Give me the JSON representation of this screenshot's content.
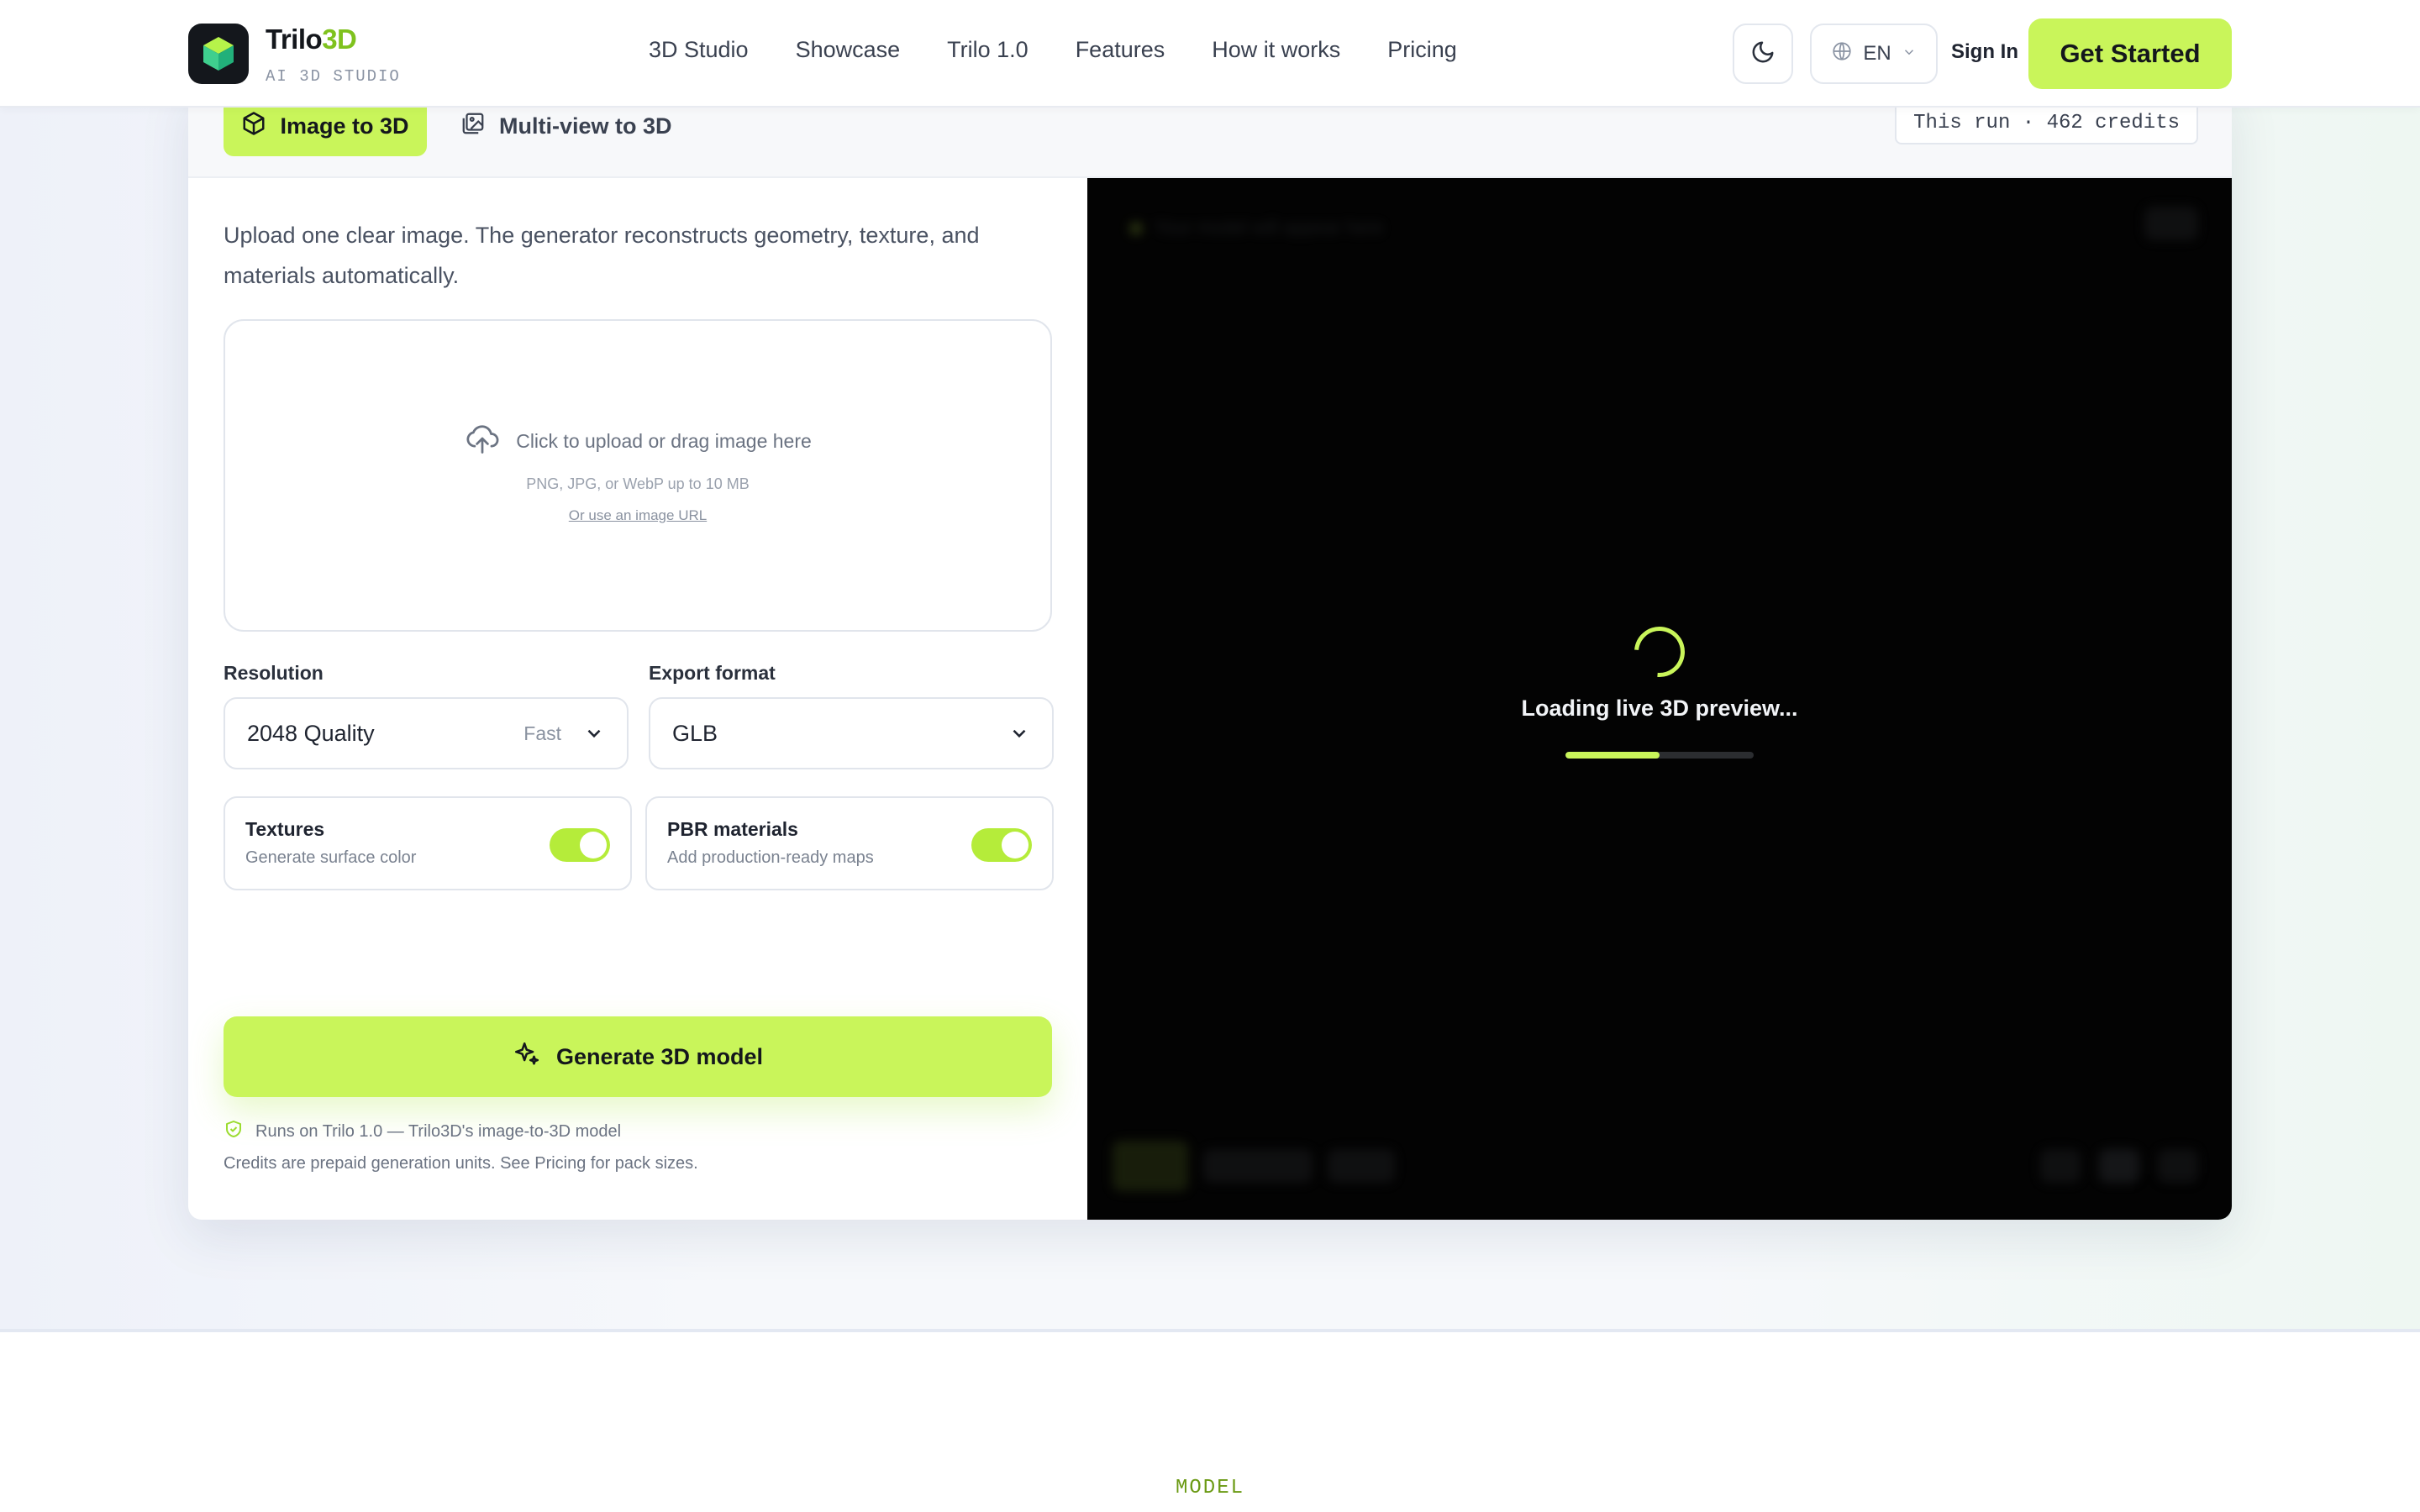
{
  "brand": {
    "name": "Trilo",
    "name_accent": "3D",
    "tagline": "AI 3D STUDIO",
    "accent_color": "#c9f55a"
  },
  "nav": {
    "items": [
      "3D Studio",
      "Showcase",
      "Trilo 1.0",
      "Features",
      "How it works",
      "Pricing"
    ]
  },
  "header": {
    "theme_icon": "moon-icon",
    "language": "EN",
    "sign_in": "Sign In",
    "cta": "Get Started"
  },
  "tabs": {
    "active": "Image to 3D",
    "inactive": "Multi-view to 3D"
  },
  "credits": {
    "label": "This run · 462 credits"
  },
  "intro": "Upload one clear image. The generator reconstructs geometry, texture, and materials automatically.",
  "upload": {
    "main": "Click to upload or drag image here",
    "sub": "PNG, JPG, or WebP up to 10 MB",
    "link": "Or use an image URL"
  },
  "resolution": {
    "label": "Resolution",
    "value": "2048 Quality",
    "hint": "Fast"
  },
  "export": {
    "label": "Export format",
    "value": "GLB"
  },
  "toggles": [
    {
      "title": "Textures",
      "desc": "Generate surface color",
      "on": true
    },
    {
      "title": "PBR materials",
      "desc": "Add production-ready maps",
      "on": true
    }
  ],
  "generate": {
    "label": "Generate 3D model"
  },
  "notes": {
    "runs_on": "Runs on Trilo 1.0 — Trilo3D's image-to-3D model",
    "credits": "Credits are prepaid generation units. See Pricing for pack sizes."
  },
  "viewer": {
    "loading_text": "Loading live 3D preview...",
    "progress": 0.5
  },
  "section": {
    "eyebrow": "MODEL"
  }
}
